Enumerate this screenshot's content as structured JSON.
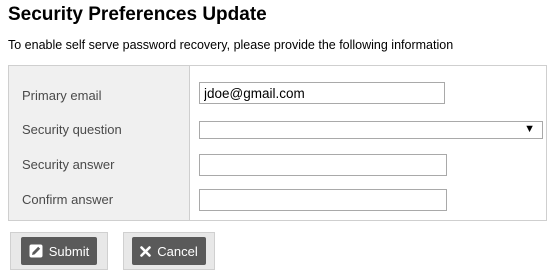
{
  "page": {
    "title": "Security Preferences Update",
    "subtitle": "To enable self serve password recovery, please provide the following information"
  },
  "form": {
    "primary_email": {
      "label": "Primary email",
      "value": "jdoe@gmail.com"
    },
    "security_question": {
      "label": "Security question",
      "value": "",
      "caret": "▼"
    },
    "security_answer": {
      "label": "Security answer",
      "value": ""
    },
    "confirm_answer": {
      "label": "Confirm answer",
      "value": ""
    }
  },
  "buttons": {
    "submit": {
      "label": "Submit",
      "icon": "pencil-square-icon"
    },
    "cancel": {
      "label": "Cancel",
      "icon": "x-icon"
    }
  },
  "colors": {
    "label_column_bg": "#f0f0f0",
    "button_fill": "#5a5a5a",
    "button_frame": "#e8e8e8"
  }
}
